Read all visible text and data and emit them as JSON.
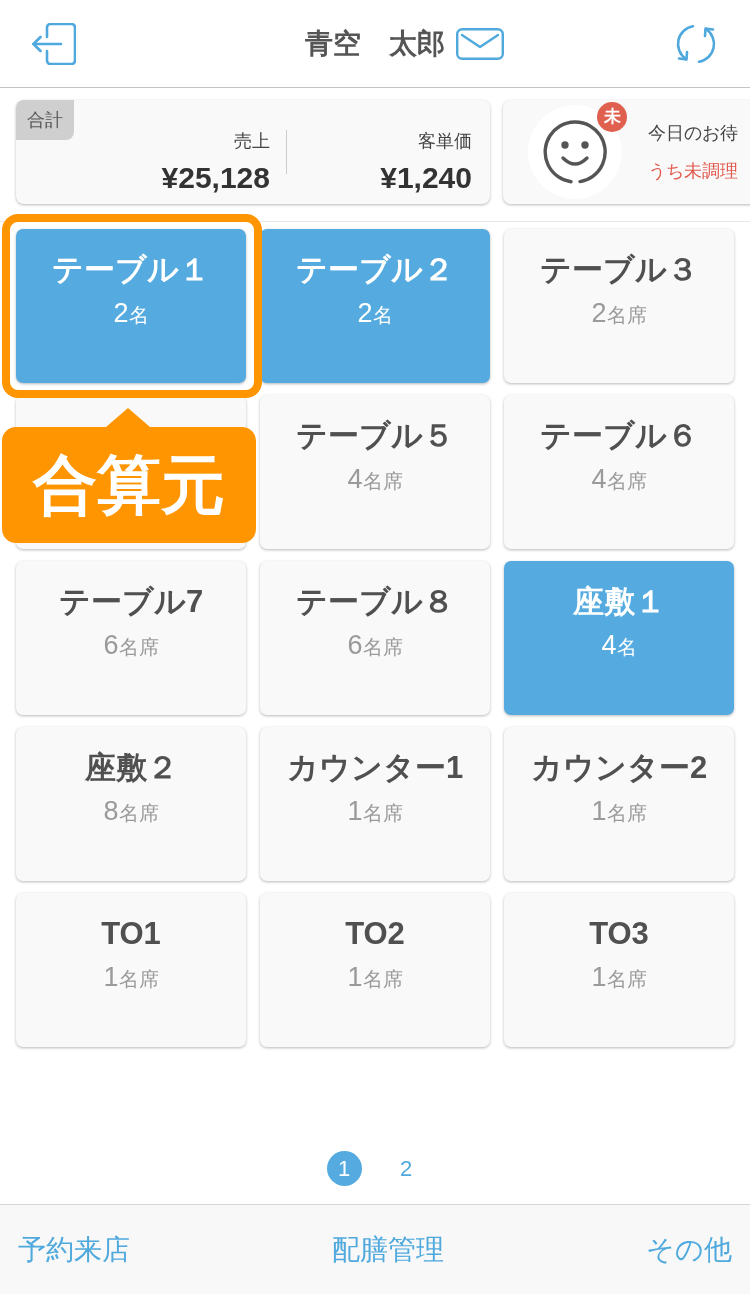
{
  "header": {
    "user_name": "青空　太郎"
  },
  "summary": {
    "tag": "合計",
    "metrics": [
      {
        "label": "売上",
        "value": "¥25,128"
      },
      {
        "label": "客単価",
        "value": "¥1,240"
      }
    ]
  },
  "waiting_card": {
    "badge": "未",
    "title": "今日のお待",
    "subtitle": "うち未調理"
  },
  "tables": [
    {
      "name": "テーブル１",
      "count": "2",
      "unit": "名",
      "occupied": true,
      "selected": true
    },
    {
      "name": "テーブル２",
      "count": "2",
      "unit": "名",
      "occupied": true,
      "selected": false
    },
    {
      "name": "テーブル３",
      "count": "2",
      "unit": "名席",
      "occupied": false,
      "selected": false
    },
    {
      "occupied": false,
      "selected": false
    },
    {
      "name": "テーブル５",
      "count": "4",
      "unit": "名席",
      "occupied": false,
      "selected": false
    },
    {
      "name": "テーブル６",
      "count": "4",
      "unit": "名席",
      "occupied": false,
      "selected": false
    },
    {
      "name": "テーブル7",
      "count": "6",
      "unit": "名席",
      "occupied": false,
      "selected": false
    },
    {
      "name": "テーブル８",
      "count": "6",
      "unit": "名席",
      "occupied": false,
      "selected": false
    },
    {
      "name": "座敷１",
      "count": "4",
      "unit": "名",
      "occupied": true,
      "selected": false
    },
    {
      "name": "座敷２",
      "count": "8",
      "unit": "名席",
      "occupied": false,
      "selected": false
    },
    {
      "name": "カウンター1",
      "count": "1",
      "unit": "名席",
      "occupied": false,
      "selected": false
    },
    {
      "name": "カウンター2",
      "count": "1",
      "unit": "名席",
      "occupied": false,
      "selected": false
    },
    {
      "name": "TO1",
      "count": "1",
      "unit": "名席",
      "occupied": false,
      "selected": false
    },
    {
      "name": "TO2",
      "count": "1",
      "unit": "名席",
      "occupied": false,
      "selected": false
    },
    {
      "name": "TO3",
      "count": "1",
      "unit": "名席",
      "occupied": false,
      "selected": false
    }
  ],
  "callout": {
    "label": "合算元"
  },
  "pagination": [
    {
      "label": "1",
      "selected": true
    },
    {
      "label": "2",
      "selected": false
    }
  ],
  "bottom_nav": [
    {
      "label": "予約来店"
    },
    {
      "label": "配膳管理"
    },
    {
      "label": "その他"
    }
  ]
}
